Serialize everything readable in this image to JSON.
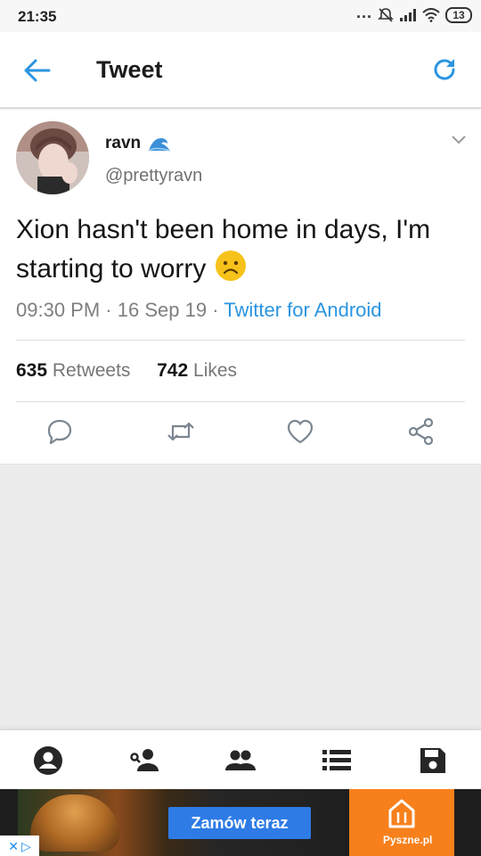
{
  "status_bar": {
    "time": "21:35",
    "dots": "...",
    "battery": "13"
  },
  "header": {
    "title": "Tweet"
  },
  "tweet": {
    "author_name": "ravn",
    "name_emoji_icon": "water-wave-icon",
    "handle": "@prettyravn",
    "text": "Xion hasn't been home in days, I'm starting to worry",
    "text_emoji_icon": "frowning-face-icon",
    "time": "09:30 PM",
    "date": "16 Sep 19",
    "source": "Twitter for Android",
    "retweets_count": "635",
    "retweets_label": "Retweets",
    "likes_count": "742",
    "likes_label": "Likes"
  },
  "actions": [
    "reply-icon",
    "retweet-icon",
    "like-icon",
    "share-icon"
  ],
  "bottom_nav": [
    "account-icon",
    "add-person-icon",
    "people-icon",
    "list-icon",
    "save-icon"
  ],
  "ad": {
    "cta": "Zamów teraz",
    "brand": "Pyszne.pl"
  },
  "colors": {
    "accent": "#2a95e0",
    "text": "#151515",
    "muted": "#7f7f7f",
    "ad_orange": "#f7801c",
    "ad_button": "#2e7be6"
  }
}
